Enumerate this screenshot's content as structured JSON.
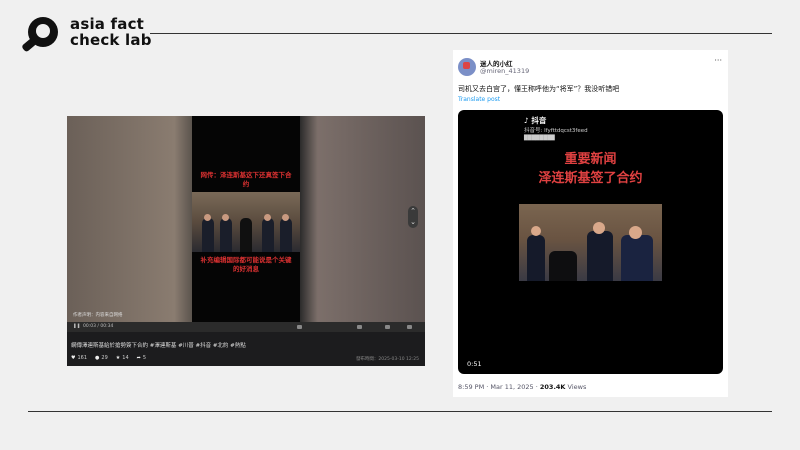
{
  "brand": {
    "line1": "asia fact",
    "line2": "check lab"
  },
  "left_post": {
    "caption_top": "网传：泽连斯基这下还真签下合约",
    "caption_bottom": "补充编辑国际都可能说是个关键的好消息",
    "watermark_note": "作者声明：内容来自网络",
    "controls_time": "00:03 / 00:34",
    "description": "網傳澤連斯基給於搶勢簽下合約 #澤連斯基 #川普 #抖音 #北約 #熱點",
    "stats": {
      "likes": "161",
      "comments": "29",
      "favorites": "14",
      "shares": "5"
    },
    "date": "發布時間：2025-03-10 12:25"
  },
  "tweet": {
    "display_name": "迷人的小红",
    "handle": "@miren_41319",
    "more": "···",
    "text": "司机又去白宫了，懂王称呼他为“将军”？我没听错吧",
    "translate": "Translate post",
    "media": {
      "app_name": "抖音",
      "app_id": "抖音号: lfyfttdqcst3feed",
      "sub": "████████",
      "headline_1": "重要新闻",
      "headline_2": "泽连斯基签了合约",
      "duration": "0:51"
    },
    "time": "8:59 PM · Mar 11, 2025 · ",
    "views_value": "203.4K",
    "views_label": " Views"
  }
}
